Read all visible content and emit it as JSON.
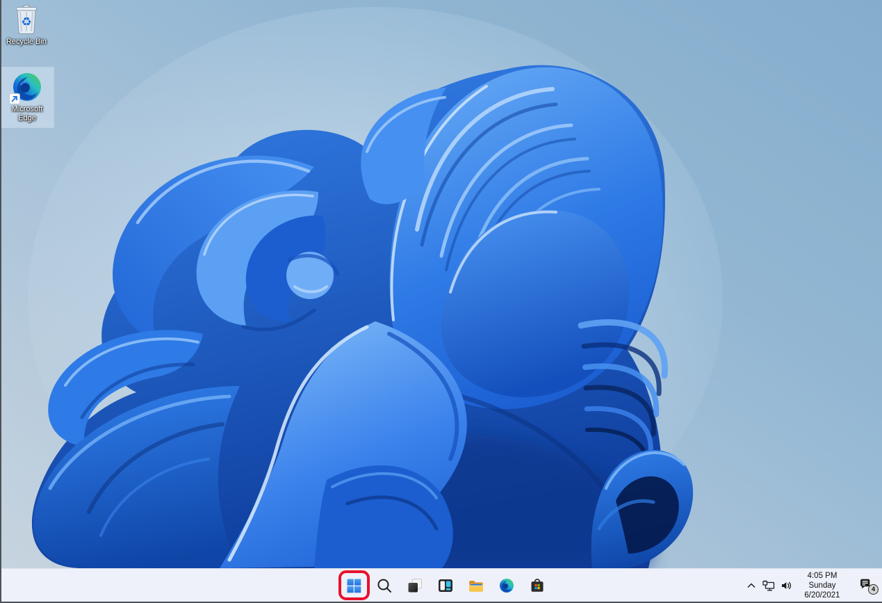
{
  "desktop": {
    "icons": [
      {
        "name": "recycle-bin",
        "label": "Recycle Bin",
        "selected": false
      },
      {
        "name": "microsoft-edge",
        "label_line1": "Microsoft",
        "label_line2": "Edge",
        "selected": true
      }
    ]
  },
  "taskbar": {
    "buttons": [
      {
        "name": "start",
        "icon": "windows-logo-icon"
      },
      {
        "name": "search",
        "icon": "search-icon"
      },
      {
        "name": "task-view",
        "icon": "task-view-icon"
      },
      {
        "name": "widgets",
        "icon": "widgets-icon"
      },
      {
        "name": "file-explorer",
        "icon": "folder-icon"
      },
      {
        "name": "microsoft-edge",
        "icon": "edge-swirl-icon"
      },
      {
        "name": "microsoft-store",
        "icon": "store-bag-icon"
      }
    ],
    "tray": {
      "chevron_icon": "chevron-up-icon",
      "network_icon": "network-ethernet-icon",
      "volume_icon": "speaker-volume-icon",
      "clock": {
        "time": "4:05 PM",
        "weekday": "Sunday",
        "date": "6/20/2021"
      },
      "notification": {
        "icon": "notification-bubble-icon",
        "badge_count": "4"
      }
    }
  },
  "annotation": {
    "type": "highlight-box",
    "target": "start-button",
    "color": "#e8112d"
  },
  "colors": {
    "taskbar_bg": "#eef1f9",
    "desktop_gradient_light": "#c7d4df",
    "desktop_gradient_dark": "#84adcc",
    "bloom_blue": "#2268d8",
    "bloom_shadow": "#041a4d",
    "annotation_red": "#e8112d",
    "selection_highlight": "rgba(212,228,242,0.55)"
  }
}
